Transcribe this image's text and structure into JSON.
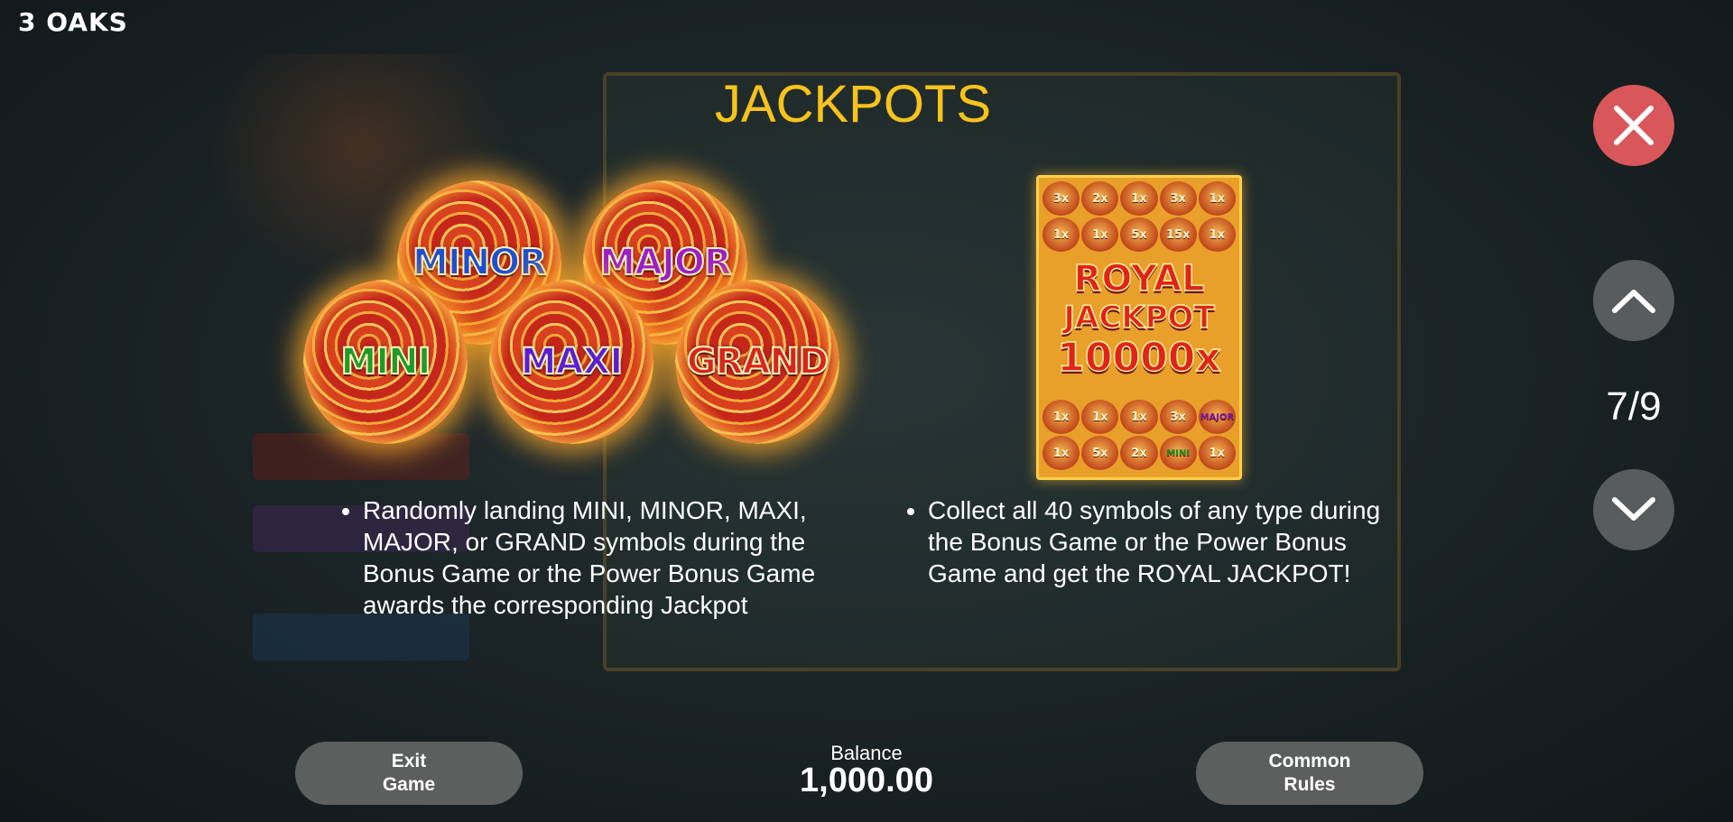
{
  "brand": {
    "logo": "3 OAKS"
  },
  "header": {
    "title": "JACKPOTS"
  },
  "orbs": {
    "minor": "MINOR",
    "major": "MAJOR",
    "mini": "MINI",
    "maxi": "MAXI",
    "grand": "GRAND"
  },
  "royal_card": {
    "line1": "ROYAL",
    "line2": "JACKPOT",
    "line3": "10000x",
    "top_rows": [
      [
        "3x",
        "2x",
        "1x",
        "3x",
        "1x"
      ],
      [
        "1x",
        "1x",
        "5x",
        "15x",
        "1x"
      ]
    ],
    "bottom_rows": [
      [
        "1x",
        "1x",
        "1x",
        "3x",
        "MAJOR"
      ],
      [
        "1x",
        "5x",
        "2x",
        "MINI",
        "1x"
      ]
    ]
  },
  "descriptions": {
    "left": "Randomly landing MINI, MINOR, MAXI, MAJOR, or GRAND symbols during the Bonus Game or the Power Bonus Game awards the corresponding Jackpot",
    "right": "Collect all 40 symbols of any type during the Bonus Game or the Power Bonus Game and get the ROYAL JACKPOT!"
  },
  "pager": {
    "text": "7/9"
  },
  "footer": {
    "exit_label": "Exit\nGame",
    "balance_label": "Balance",
    "balance_value": "1,000.00",
    "common_rules_label": "Common\nRules"
  },
  "icons": {
    "close": "close-icon",
    "up": "chevron-up-icon",
    "down": "chevron-down-icon"
  },
  "colors": {
    "title": "#f6c21c",
    "close_button": "#d9565a",
    "nav_button": "#575c5d",
    "pill_button": "#5b605f",
    "orb_minor": "#1f4fd1",
    "orb_major": "#9a1fc8",
    "orb_mini": "#1f9a2a",
    "orb_maxi": "#5a1fd0",
    "orb_grand": "#d7261b"
  }
}
